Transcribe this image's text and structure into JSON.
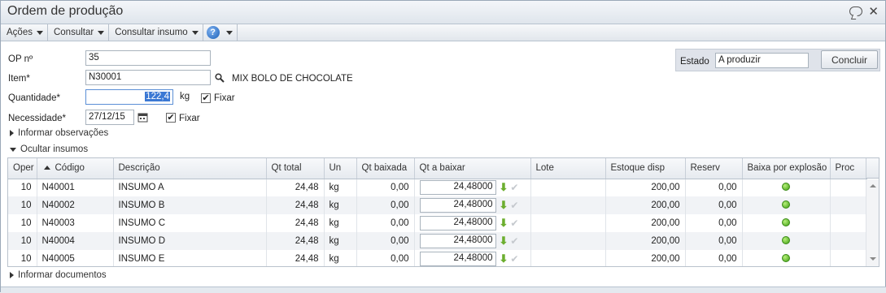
{
  "window": {
    "title": "Ordem de produção"
  },
  "menubar": {
    "items": [
      {
        "label": "Ações"
      },
      {
        "label": "Consultar"
      },
      {
        "label": "Consultar insumo"
      }
    ],
    "help_glyph": "?"
  },
  "form": {
    "op_label": "OP nº",
    "op_value": "35",
    "item_label": "Item*",
    "item_value": "N30001",
    "item_description": "MIX BOLO DE CHOCOLATE",
    "quantidade_label": "Quantidade*",
    "quantidade_value": "122,4",
    "quantidade_unit": "kg",
    "fixar_label": "Fixar",
    "necessidade_label": "Necessidade*",
    "necessidade_value": "27/12/15",
    "fixar2_label": "Fixar"
  },
  "status": {
    "estado_label": "Estado",
    "estado_value": "A produzir",
    "concluir_label": "Concluir"
  },
  "toggles": {
    "observacoes": "Informar observações",
    "ocultar_insumos": "Ocultar insumos",
    "documentos": "Informar documentos"
  },
  "grid": {
    "columns": [
      "Oper",
      "Código",
      "Descrição",
      "Qt total",
      "Un",
      "Qt baixada",
      "Qt a baixar",
      "Lote",
      "Estoque disp",
      "Reserv",
      "Baixa por explosão",
      "Proc"
    ],
    "rows": [
      {
        "oper": "10",
        "codigo": "N40001",
        "descricao": "INSUMO A",
        "qt_total": "24,48",
        "un": "kg",
        "qt_baixada": "0,00",
        "qt_a_baixar": "24,48000",
        "lote": "",
        "estoque": "200,00",
        "reserv": "0,00"
      },
      {
        "oper": "10",
        "codigo": "N40002",
        "descricao": "INSUMO B",
        "qt_total": "24,48",
        "un": "kg",
        "qt_baixada": "0,00",
        "qt_a_baixar": "24,48000",
        "lote": "",
        "estoque": "200,00",
        "reserv": "0,00"
      },
      {
        "oper": "10",
        "codigo": "N40003",
        "descricao": "INSUMO C",
        "qt_total": "24,48",
        "un": "kg",
        "qt_baixada": "0,00",
        "qt_a_baixar": "24,48000",
        "lote": "",
        "estoque": "200,00",
        "reserv": "0,00"
      },
      {
        "oper": "10",
        "codigo": "N40004",
        "descricao": "INSUMO D",
        "qt_total": "24,48",
        "un": "kg",
        "qt_baixada": "0,00",
        "qt_a_baixar": "24,48000",
        "lote": "",
        "estoque": "200,00",
        "reserv": "0,00"
      },
      {
        "oper": "10",
        "codigo": "N40005",
        "descricao": "INSUMO E",
        "qt_total": "24,48",
        "un": "kg",
        "qt_baixada": "0,00",
        "qt_a_baixar": "24,48000",
        "lote": "",
        "estoque": "200,00",
        "reserv": "0,00"
      }
    ]
  },
  "icons": {
    "chat": "chat-bubble-icon",
    "close": "close-icon",
    "search": "search-icon",
    "calendar": "calendar-icon",
    "arrow_down": "green-down-arrow-icon",
    "check": "check-icon",
    "status_dot": "green-status-dot-icon"
  },
  "colors": {
    "accent": "#3b78d4",
    "status_green": "#3f9e12"
  }
}
